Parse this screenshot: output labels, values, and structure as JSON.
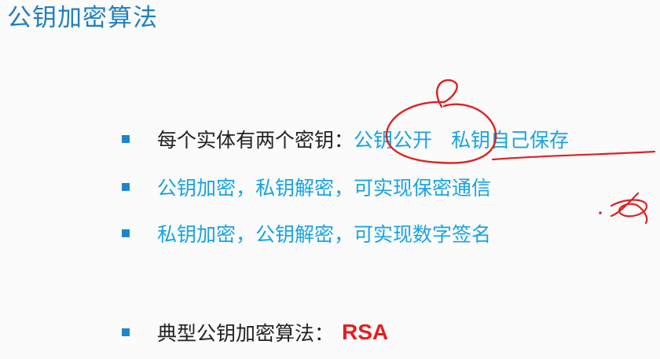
{
  "title": "公钥加密算法",
  "bullets": [
    {
      "prefix": "每个实体有两个密钥：",
      "public": "公钥公开",
      "private": "私钥自己保存"
    },
    {
      "text": "公钥加密，私钥解密，可实现保密通信"
    },
    {
      "text": "私钥加密，公钥解密，可实现数字签名"
    },
    {
      "prefix": "典型公钥加密算法：",
      "algo": "RSA"
    }
  ],
  "colors": {
    "title": "#1e7fc4",
    "bullet_square": "#1a86d0",
    "highlight_text": "#17a3e5",
    "body_text": "#222222",
    "emphasis": "#e81c1c",
    "annotation_ink": "#e02020"
  }
}
